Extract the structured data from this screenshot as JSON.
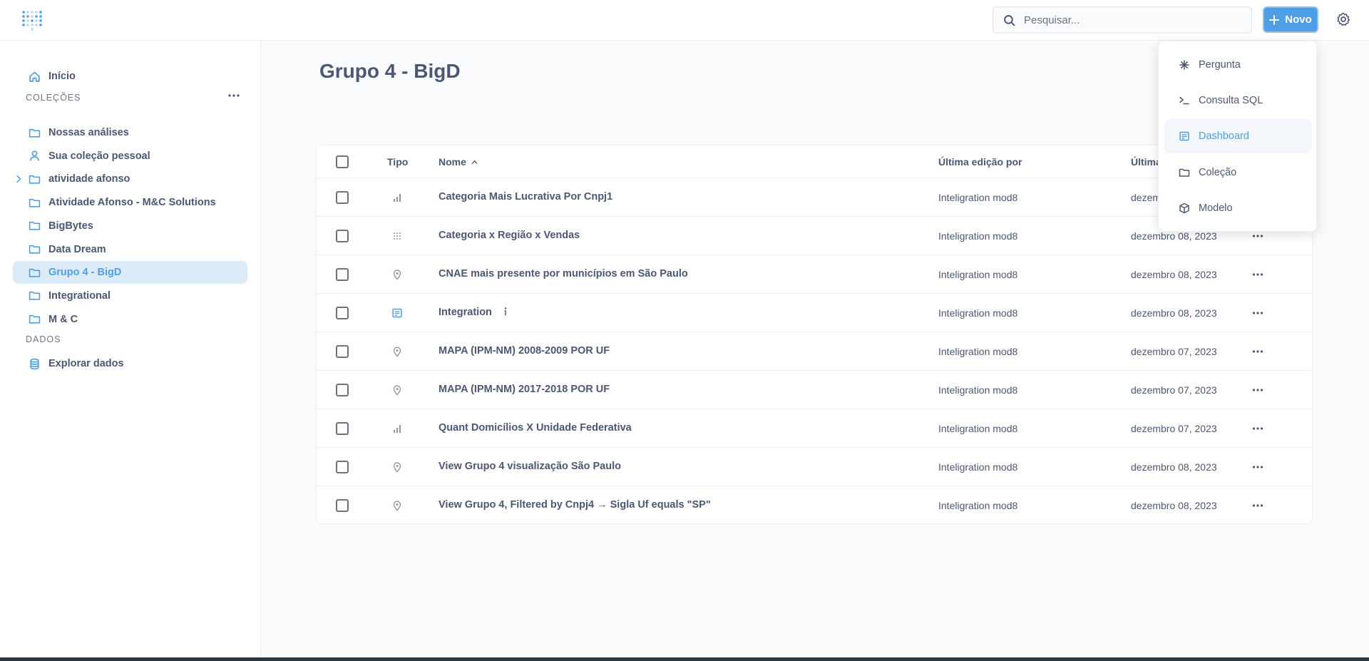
{
  "topbar": {
    "search_placeholder": "Pesquisar...",
    "new_button_label": "Novo"
  },
  "sidebar": {
    "home_label": "Início",
    "collections_heading": "COLEÇÕES",
    "collections": [
      {
        "label": "Nossas análises",
        "icon": "folder-icon"
      },
      {
        "label": "Sua coleção pessoal",
        "icon": "person-icon"
      },
      {
        "label": "atividade afonso",
        "icon": "folder-icon",
        "expandable": true
      },
      {
        "label": "Atividade Afonso - M&C Solutions",
        "icon": "folder-icon"
      },
      {
        "label": "BigBytes",
        "icon": "folder-icon"
      },
      {
        "label": "Data Dream",
        "icon": "folder-icon"
      },
      {
        "label": "Grupo 4 - BigD",
        "icon": "folder-icon",
        "active": true
      },
      {
        "label": "Integrational",
        "icon": "folder-icon"
      },
      {
        "label": "M & C",
        "icon": "folder-icon"
      }
    ],
    "data_heading": "DADOS",
    "explore_label": "Explorar dados"
  },
  "main": {
    "title": "Grupo 4 - BigD",
    "table": {
      "headers": {
        "type": "Tipo",
        "name": "Nome",
        "editor": "Última edição por",
        "date": "Última"
      },
      "rows": [
        {
          "type": "bar-chart-icon",
          "name": "Categoria Mais Lucrativa Por Cnpj1",
          "editor": "Inteligration mod8",
          "date": "dezembro 08, 2023"
        },
        {
          "type": "grid-icon",
          "name": "Categoria x Região x Vendas",
          "editor": "Inteligration mod8",
          "date": "dezembro 08, 2023"
        },
        {
          "type": "pin-icon",
          "name": "CNAE mais presente por municípios em São Paulo",
          "editor": "Inteligration mod8",
          "date": "dezembro 08, 2023"
        },
        {
          "type": "dashboard-icon",
          "name": "Integration",
          "editor": "Inteligration mod8",
          "date": "dezembro 08, 2023",
          "info": true
        },
        {
          "type": "pin-icon",
          "name": "MAPA (IPM-NM) 2008-2009 POR UF",
          "editor": "Inteligration mod8",
          "date": "dezembro 07, 2023"
        },
        {
          "type": "pin-icon",
          "name": "MAPA (IPM-NM) 2017-2018 POR UF",
          "editor": "Inteligration mod8",
          "date": "dezembro 07, 2023"
        },
        {
          "type": "bar-chart-icon",
          "name": "Quant Domicílios X Unidade Federativa",
          "editor": "Inteligration mod8",
          "date": "dezembro 07, 2023"
        },
        {
          "type": "pin-icon",
          "name": "View Grupo 4 visualização São Paulo",
          "editor": "Inteligration mod8",
          "date": "dezembro 08, 2023"
        },
        {
          "type": "pin-icon",
          "name": "View Grupo 4, Filtered by Cnpj4 → Sigla Uf equals \"SP\"",
          "editor": "Inteligration mod8",
          "date": "dezembro 08, 2023"
        }
      ]
    }
  },
  "new_menu": {
    "items": [
      {
        "label": "Pergunta",
        "icon": "question-icon"
      },
      {
        "label": "Consulta SQL",
        "icon": "sql-icon"
      },
      {
        "label": "Dashboard",
        "icon": "dashboard-icon",
        "highlighted": true
      },
      {
        "label": "Coleção",
        "icon": "folder-icon"
      },
      {
        "label": "Modelo",
        "icon": "model-icon"
      }
    ]
  },
  "colors": {
    "brand": "#509ee3",
    "text": "#4c5773",
    "active_bg": "#dcebf8"
  }
}
